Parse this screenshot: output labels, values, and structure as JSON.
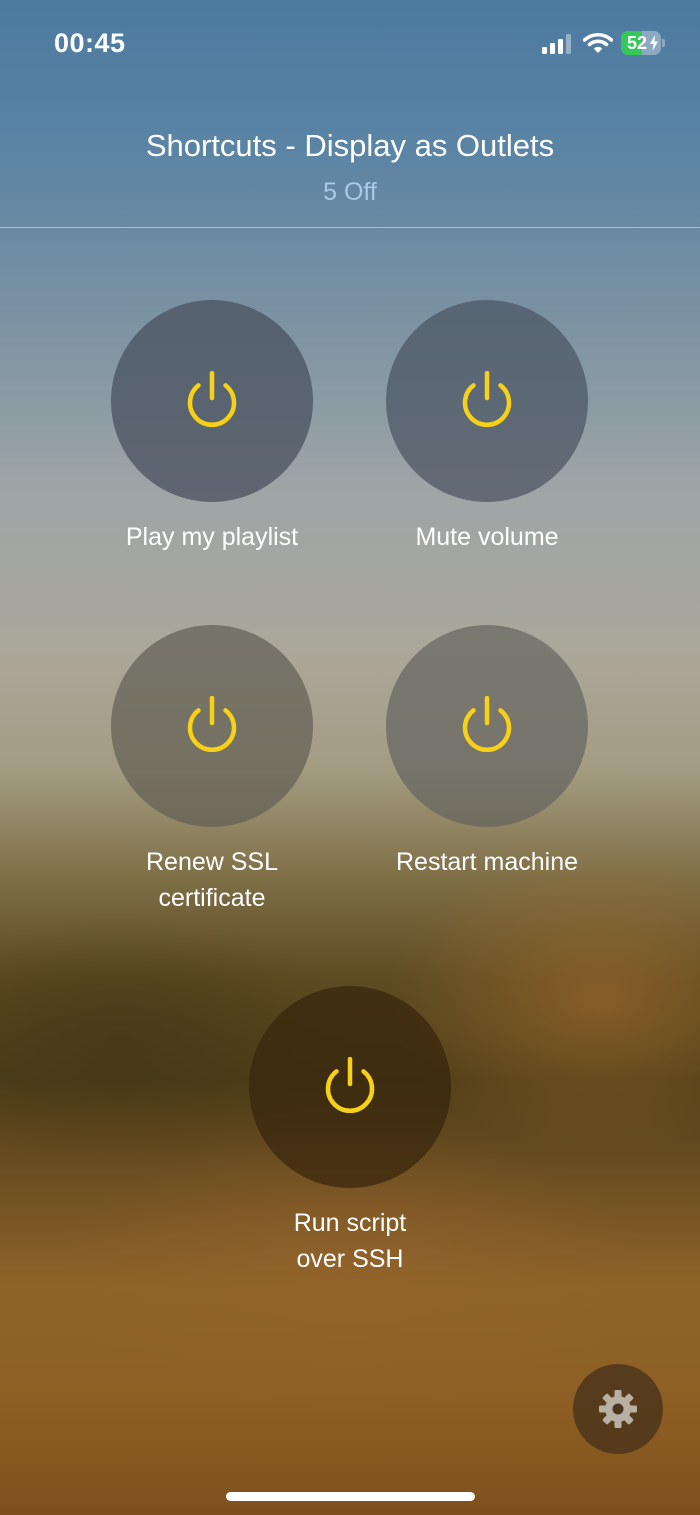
{
  "status_bar": {
    "time": "00:45",
    "battery_percent": "52",
    "battery_level": 0.52,
    "battery_charging": true,
    "battery_color": "#34c759",
    "signal_icon": "cellular-signal-icon",
    "wifi_icon": "wifi-icon"
  },
  "header": {
    "title": "Shortcuts - Display as Outlets",
    "subtitle": "5 Off"
  },
  "colors": {
    "power_icon": "#f7d117",
    "subtitle": "#a9c8ea"
  },
  "outlets": [
    {
      "label": "Play my playlist",
      "state": "off",
      "icon": "power-icon",
      "button_color": "rgba(75,85,98,0.78)"
    },
    {
      "label": "Mute volume",
      "state": "off",
      "icon": "power-icon",
      "button_color": "rgba(75,85,98,0.72)"
    },
    {
      "label": "Renew SSL certificate",
      "state": "off",
      "icon": "power-icon",
      "button_color": "rgba(98,96,86,0.72)"
    },
    {
      "label": "Restart machine",
      "state": "off",
      "icon": "power-icon",
      "button_color": "rgba(100,100,95,0.7)"
    },
    {
      "label": "Run script over SSH",
      "state": "off",
      "icon": "power-icon",
      "button_color": "rgba(55,38,12,0.72)"
    }
  ],
  "settings": {
    "icon": "gear-icon"
  }
}
